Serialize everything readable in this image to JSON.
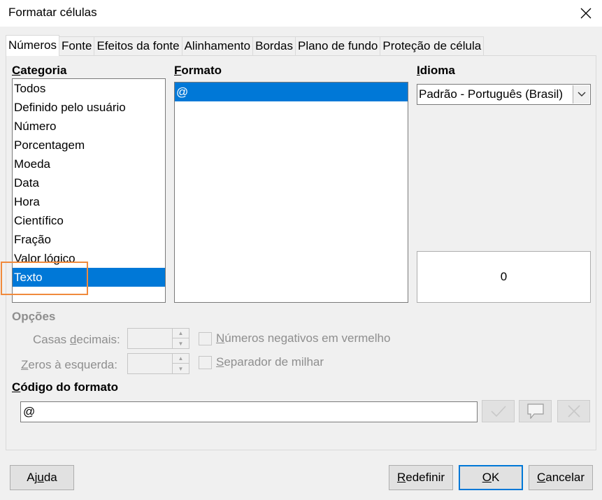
{
  "window": {
    "title": "Formatar células"
  },
  "tabs": [
    {
      "label": "Números",
      "active": true
    },
    {
      "label": "Fonte",
      "active": false
    },
    {
      "label": "Efeitos da fonte",
      "active": false
    },
    {
      "label": "Alinhamento",
      "active": false
    },
    {
      "label": "Bordas",
      "active": false
    },
    {
      "label": "Plano de fundo",
      "active": false
    },
    {
      "label": "Proteção de célula",
      "active": false
    }
  ],
  "category": {
    "label_access": "C",
    "label_rest": "ategoria",
    "items": [
      "Todos",
      "Definido pelo usuário",
      "Número",
      "Porcentagem",
      "Moeda",
      "Data",
      "Hora",
      "Científico",
      "Fração",
      "Valor lógico",
      "Texto"
    ],
    "selected": "Texto"
  },
  "format": {
    "label_access": "F",
    "label_rest": "ormato",
    "items": [
      "@"
    ],
    "selected": "@"
  },
  "language": {
    "label_access": "I",
    "label_rest": "dioma",
    "value": "Padrão - Português (Brasil)"
  },
  "preview": {
    "value": "0"
  },
  "options": {
    "heading": "Opções",
    "decimal_places_pre": "Casas ",
    "decimal_places_access": "d",
    "decimal_places_post": "ecimais:",
    "leading_zeros_access": "Z",
    "leading_zeros_post": "eros à esquerda:",
    "negative_red_access": "N",
    "negative_red_post": "úmeros negativos em vermelho",
    "thousands_sep_access": "S",
    "thousands_sep_post": "eparador de milhar"
  },
  "format_code": {
    "label_access": "C",
    "label_rest": "ódigo do formato",
    "value": "@"
  },
  "buttons": {
    "help_pre": "Aj",
    "help_access": "u",
    "help_post": "da",
    "reset_access": "R",
    "reset_post": "edefinir",
    "ok_access": "O",
    "ok_post": "K",
    "cancel_access": "C",
    "cancel_post": "ancelar"
  },
  "colors": {
    "accent": "#0078d7",
    "highlight": "#f08a3c"
  }
}
